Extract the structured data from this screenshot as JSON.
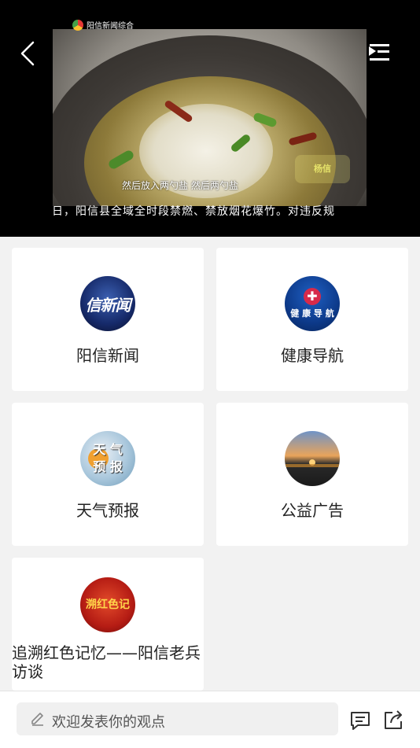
{
  "player": {
    "channel_name": "阳信新闻综合",
    "subtitle": "然后放入两勺盐 然后两勺盐",
    "corner_logo": "杨信",
    "ticker": "日，阳信县全域全时段禁燃、禁放烟花爆竹。对违反规"
  },
  "programs": [
    {
      "label": "阳信新闻",
      "thumb_text": "信新闻"
    },
    {
      "label": "健康导航",
      "thumb_text": "健 康 导 航"
    },
    {
      "label": "天气预报",
      "thumb_text_1": "天 气",
      "thumb_text_2": "预 报"
    },
    {
      "label": "公益广告"
    },
    {
      "label": "追溯红色记忆——阳信老兵访谈",
      "thumb_text": "溯红色记"
    }
  ],
  "comment": {
    "placeholder": "欢迎发表你的观点"
  },
  "icons": {
    "back": "chevron-left-icon",
    "playlist": "playlist-icon",
    "pen": "pen-icon",
    "comment": "comment-icon",
    "share": "share-icon"
  }
}
